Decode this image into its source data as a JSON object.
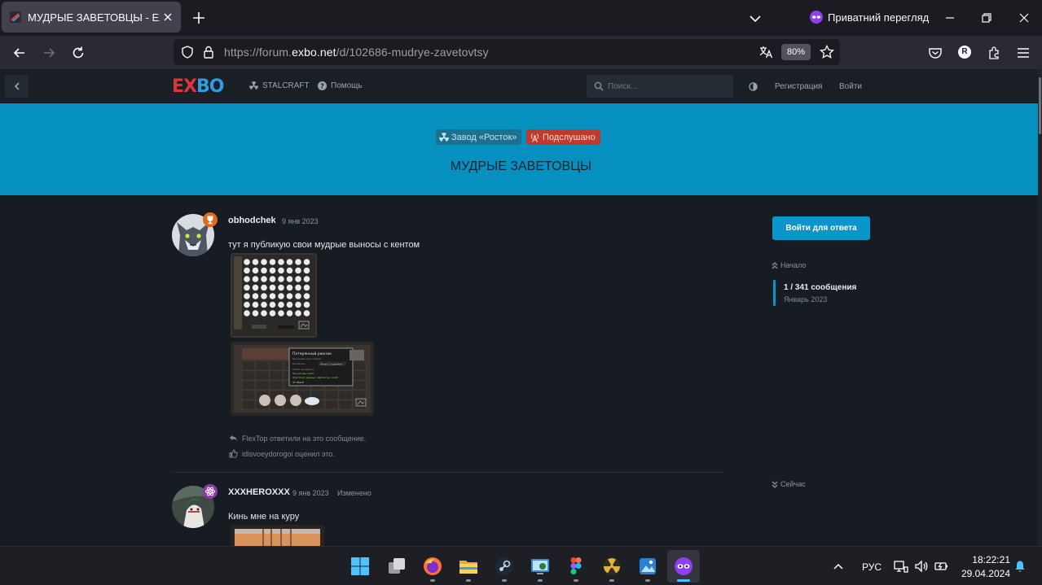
{
  "browser": {
    "tab_title": "МУДРЫЕ ЗАВЕТОВЦЫ - EXBO",
    "private_label": "Приватний перегляд",
    "url_prefix": "https://forum.",
    "url_host": "exbo.net",
    "url_path": "/d/102686-mudrye-zavetovtsy",
    "zoom": "80%",
    "account_initial": "R"
  },
  "site": {
    "logo_left": "EX",
    "logo_right": "BO",
    "nav": [
      {
        "label": "STALCRAFT",
        "icon": "radiation-icon"
      },
      {
        "label": "Помощь",
        "icon": "help-icon"
      }
    ],
    "search_placeholder": "Поиск...",
    "register": "Регистрация",
    "login": "Войти"
  },
  "discussion": {
    "tags": [
      {
        "label": "Завод «Росток»",
        "color": "#1f6f8f",
        "text_color": "#bfe6f5"
      },
      {
        "label": "Подслушано",
        "color": "#c0392b",
        "text_color": "#ffd9d4"
      }
    ],
    "title": "МУДРЫЕ ЗАВЕТОВЦЫ"
  },
  "posts": [
    {
      "username": "obhodchek",
      "date": "9 янв 2023",
      "body": "тут я публикую свои мудрые выносы с кентом",
      "badge_color": "#e06a1b",
      "replied": "FlexTop ответили на это сообщение.",
      "liked": "idisvoeydorogoi оценил это."
    },
    {
      "username": "XXXHEROXXX",
      "date": "9 янв 2023",
      "edited": "Изменено",
      "body": "Кинь мне на куру",
      "badge_color": "#8e3aa8"
    }
  ],
  "screenshot_tooltip": {
    "title": "Потерянный рюкзак",
    "lines": [
      "Выживает при смерти",
      "Владелец",
      "Петро_Гашамкин",
      "ПОКО предметы:",
      "Неонитовы x640",
      "Фрагмент данных «Детекты» x126",
      "47 050 ₽"
    ]
  },
  "sidebar": {
    "reply_button": "Войти для ответа",
    "start": "Начало",
    "count": "1 / 341 сообщения",
    "period": "Январь 2023",
    "now": "Сейчас"
  },
  "taskbar": {
    "lang": "РУС",
    "time": "18:22:21",
    "date": "29.04.2024"
  }
}
